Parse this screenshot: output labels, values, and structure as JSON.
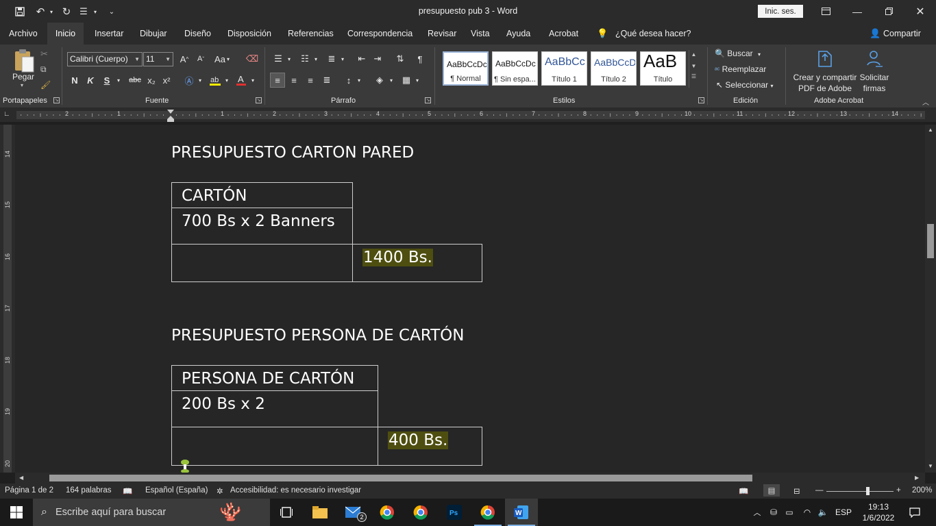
{
  "window": {
    "title": "presupuesto pub 3  -  Word",
    "signin_label": "Inic. ses."
  },
  "tabs": [
    "Archivo",
    "Inicio",
    "Insertar",
    "Dibujar",
    "Diseño",
    "Disposición",
    "Referencias",
    "Correspondencia",
    "Revisar",
    "Vista",
    "Ayuda",
    "Acrobat"
  ],
  "active_tab": "Inicio",
  "tell_me": "¿Qué desea hacer?",
  "share_label": "Compartir",
  "ribbon": {
    "clipboard": {
      "paste_label": "Pegar",
      "group_label": "Portapapeles"
    },
    "font": {
      "name": "Calibri (Cuerpo)",
      "size": "11",
      "case_label": "Aa",
      "bold": "N",
      "italic": "K",
      "underline": "S",
      "strike": "abc",
      "subscript": "x₂",
      "superscript": "x²",
      "group_label": "Fuente"
    },
    "paragraph": {
      "group_label": "Párrafo"
    },
    "styles": {
      "group_label": "Estilos",
      "items": [
        {
          "sample": "AaBbCcDc",
          "name": "¶ Normal"
        },
        {
          "sample": "AaBbCcDc",
          "name": "¶ Sin espa..."
        },
        {
          "sample": "AaBbCc",
          "name": "Título 1"
        },
        {
          "sample": "AaBbCcD",
          "name": "Título 2"
        },
        {
          "sample": "AaB",
          "name": "Título"
        }
      ]
    },
    "editing": {
      "find": "Buscar",
      "replace": "Reemplazar",
      "select": "Seleccionar",
      "group_label": "Edición"
    },
    "acrobat": {
      "create_line1": "Crear y compartir",
      "create_line2": "PDF de Adobe",
      "sign_line1": "Solicitar",
      "sign_line2": "firmas",
      "group_label": "Adobe Acrobat"
    }
  },
  "ruler": {
    "h_numbers": [
      "2",
      "1",
      "1",
      "2",
      "3",
      "4",
      "5",
      "6",
      "7",
      "8",
      "9",
      "10",
      "11",
      "12",
      "13",
      "14"
    ],
    "v_numbers": [
      "14",
      "15",
      "16",
      "17",
      "18",
      "19",
      "20"
    ]
  },
  "document": {
    "heading1": "PRESUPUESTO CARTON PARED",
    "table1": {
      "header": "CARTÓN",
      "row": "700 Bs x 2 Banners",
      "total": "1400 Bs."
    },
    "heading2": "PRESUPUESTO PERSONA DE CARTÓN",
    "table2": {
      "header": "PERSONA DE CARTÓN",
      "row": "200 Bs x 2",
      "total": "400 Bs."
    }
  },
  "statusbar": {
    "page": "Página 1 de 2",
    "words": "164 palabras",
    "language": "Español (España)",
    "accessibility": "Accesibilidad: es necesario investigar",
    "zoom": "200%"
  },
  "taskbar": {
    "search_placeholder": "Escribe aquí para buscar",
    "mail_badge": "2",
    "lang": "ESP",
    "time": "19:13",
    "date": "1/6/2022"
  },
  "colors": {
    "highlight": "#4e4e10",
    "ribbon_bg": "#3a3a3a",
    "title_bg": "#2b2b2b",
    "doc_bg": "#262626"
  }
}
